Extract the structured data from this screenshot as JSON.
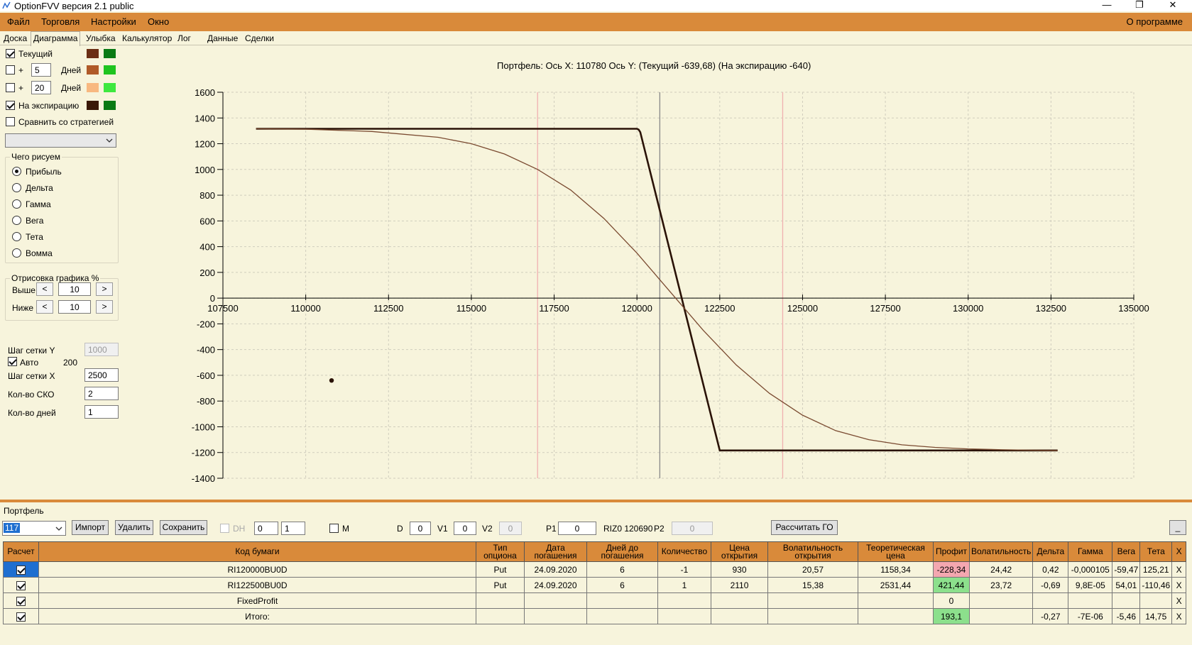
{
  "window": {
    "title": "OptionFVV версия 2.1 public",
    "minimize": "—",
    "restore": "❐",
    "close": "✕"
  },
  "menu": {
    "items": [
      "Файл",
      "Торговля",
      "Настройки",
      "Окно"
    ],
    "about": "О программе"
  },
  "tabs": [
    "Доска",
    "Диаграмма",
    "Улыбка",
    "Калькулятор",
    "Лог",
    "Данные",
    "Сделки"
  ],
  "active_tab": "Диаграмма",
  "curves": {
    "current": {
      "label": "Текущий",
      "checked": true,
      "colors": [
        "#6b2e14",
        "#0a7a14"
      ]
    },
    "plus5": {
      "plus": "+",
      "days_value": "5",
      "days_label": "Дней",
      "checked": false,
      "colors": [
        "#b05a28",
        "#1fc41f"
      ]
    },
    "plus20": {
      "plus": "+",
      "days_value": "20",
      "days_label": "Дней",
      "checked": false,
      "colors": [
        "#f8b880",
        "#3ee83e"
      ]
    },
    "expiration": {
      "label": "На экспирацию",
      "checked": true,
      "colors": [
        "#3a1808",
        "#0a7a14"
      ]
    },
    "compare": {
      "label": "Сравнить со стратегией",
      "checked": false
    }
  },
  "draw_group": {
    "title": "Чего рисуем",
    "options": [
      "Прибыль",
      "Дельта",
      "Гамма",
      "Вега",
      "Тета",
      "Вомма"
    ],
    "selected": "Прибыль"
  },
  "percent_group": {
    "title": "Отрисовка графика %",
    "above_label": "Выше",
    "above_value": "10",
    "below_label": "Ниже",
    "below_value": "10",
    "left": "<",
    "right": ">"
  },
  "grid_settings": {
    "step_y_label": "Шаг сетки Y",
    "step_y_value": "1000",
    "auto_label": "Авто",
    "auto_checked": true,
    "auto_value": "200",
    "step_x_label": "Шаг сетки X",
    "step_x_value": "2500",
    "sko_label": "Кол-во СКО",
    "sko_value": "2",
    "days_label": "Кол-во дней",
    "days_value": "1"
  },
  "chart_title": "Портфель: Ось X:  110780 Ось Y:   (Текущий -639,68)  (На экспирацию -640)",
  "chart_data": {
    "type": "line",
    "xlim": [
      107500,
      135000
    ],
    "ylim": [
      -1400,
      1600
    ],
    "x_ticks": [
      107500,
      110000,
      112500,
      115000,
      117500,
      120000,
      122500,
      125000,
      127500,
      130000,
      132500,
      135000
    ],
    "y_ticks": [
      1600,
      1400,
      1200,
      1000,
      800,
      600,
      400,
      200,
      0,
      -200,
      -400,
      -600,
      -800,
      -1000,
      -1200,
      -1400
    ],
    "grid": true,
    "legend": "none",
    "vlines": [
      {
        "x": 117000,
        "color": "#f0b0b0"
      },
      {
        "x": 120690,
        "color": "#888888"
      },
      {
        "x": 124400,
        "color": "#f0b0b0"
      }
    ],
    "series": [
      {
        "color": "#2a1206",
        "x": [
          108500,
          120000,
          120050,
          120100,
          122500,
          122600,
          132700
        ],
        "y": [
          1316,
          1316,
          1310,
          1290,
          -1184,
          -1184,
          -1184
        ]
      },
      {
        "color": "#7a4a30",
        "x": [
          108500,
          110000,
          112000,
          114000,
          115000,
          116000,
          117000,
          118000,
          119000,
          120000,
          121000,
          122000,
          123000,
          124000,
          125000,
          126000,
          127000,
          128000,
          129000,
          130000,
          131000,
          132000,
          132700
        ],
        "y": [
          1316,
          1313,
          1295,
          1250,
          1200,
          1120,
          1000,
          840,
          620,
          350,
          50,
          -250,
          -520,
          -740,
          -910,
          -1030,
          -1100,
          -1140,
          -1160,
          -1172,
          -1178,
          -1182,
          -1184
        ]
      }
    ],
    "marker": {
      "x": 110780,
      "y": -640
    }
  },
  "portfolio": {
    "label": "Портфель",
    "selected": "117",
    "import": "Импорт",
    "delete": "Удалить",
    "save": "Сохранить",
    "dh": "DH",
    "spin1": "0",
    "spin2": "1",
    "m": "M",
    "d_label": "D",
    "d_value": "0",
    "v1_label": "V1",
    "v1_value": "0",
    "v2_label": "V2",
    "v2_value": "0",
    "p1_label": "P1",
    "p1_value": "0",
    "instrument": "RIZ0 120690",
    "p2_label": "P2",
    "p2_value": "0",
    "calc_go": "Рассчитать ГО",
    "collapse": "_"
  },
  "table": {
    "headers": [
      "Расчет",
      "Код бумаги",
      "Тип опциона",
      "Дата погашения",
      "Дней до погашения",
      "Количество",
      "Цена открытия",
      "Волатильность открытия",
      "Теоретическая цена",
      "Профит",
      "Волатильность",
      "Дельта",
      "Гамма",
      "Вега",
      "Тета",
      "X"
    ],
    "rows": [
      [
        "RI120000BU0D",
        "Put",
        "24.09.2020",
        "6",
        "-1",
        "930",
        "20,57",
        "1158,34",
        "-228,34",
        "24,42",
        "0,42",
        "-0,000105",
        "-59,47",
        "125,21",
        "X"
      ],
      [
        "RI122500BU0D",
        "Put",
        "24.09.2020",
        "6",
        "1",
        "2110",
        "15,38",
        "2531,44",
        "421,44",
        "23,72",
        "-0,69",
        "9,8E-05",
        "54,01",
        "-110,46",
        "X"
      ],
      [
        "FixedProfit",
        "",
        "",
        "",
        "",
        "",
        "",
        "",
        "0",
        "",
        "",
        "",
        "",
        "",
        "X"
      ],
      [
        "Итого:",
        "",
        "",
        "",
        "",
        "",
        "",
        "",
        "193,1",
        "",
        "-0,27",
        "-7E-06",
        "-5,46",
        "14,75",
        "X"
      ]
    ]
  }
}
